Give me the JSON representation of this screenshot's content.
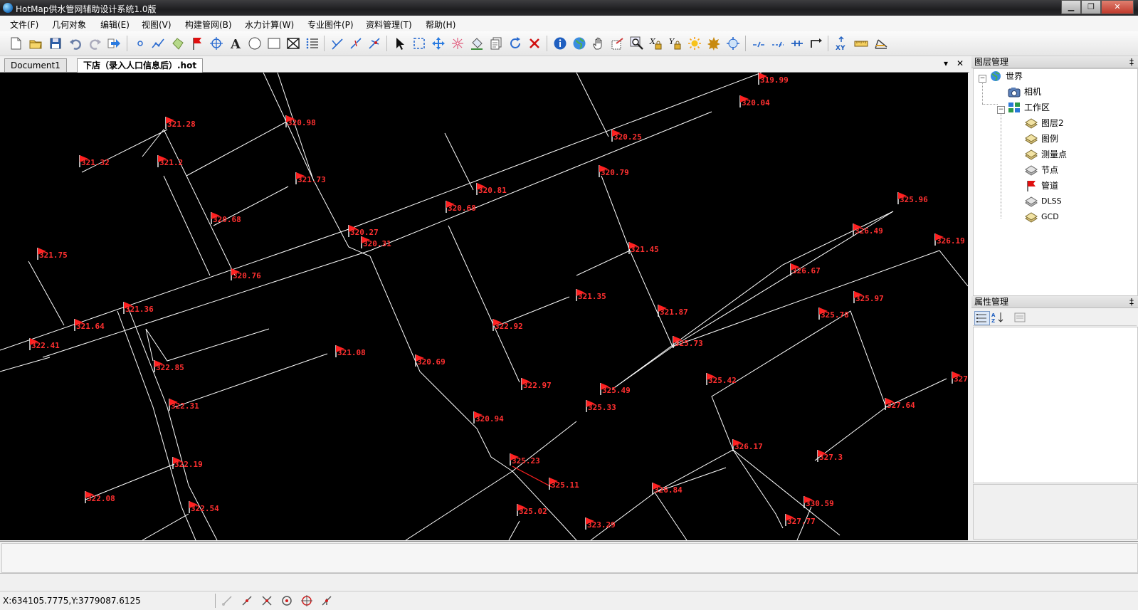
{
  "window": {
    "title": "HotMap供水管网辅助设计系统1.0版",
    "min_label": "▁",
    "max_label": "❐",
    "close_label": "✕"
  },
  "menu": [
    "文件(F)",
    "几何对象",
    "编辑(E)",
    "视图(V)",
    "构建管网(B)",
    "水力计算(W)",
    "专业图件(P)",
    "资料管理(T)",
    "帮助(H)"
  ],
  "tabs": [
    {
      "label": "Document1",
      "active": false
    },
    {
      "label": "下店（录入人口信息后）.hot",
      "active": true
    }
  ],
  "tab_controls": {
    "dropdown": "▾",
    "close": "✕"
  },
  "layer_panel": {
    "title": "图层管理",
    "pin": "‡",
    "root": "世界",
    "camera": "相机",
    "workspace": "工作区",
    "layers": [
      "图层2",
      "图例",
      "测量点",
      "节点",
      "管道",
      "DLSS",
      "GCD"
    ]
  },
  "property_panel": {
    "title": "属性管理",
    "pin": "‡"
  },
  "status": {
    "coords": "X:634105.7775,Y:3779087.6125"
  },
  "map": {
    "background": "#000000",
    "line_color": "#ffffff",
    "highlight_color": "#ff2020",
    "label_color": "#ff3030",
    "labels": [
      "319.99",
      "320.04",
      "320.25",
      "320.79",
      "320.81",
      "320.68",
      "320.98",
      "321.28",
      "321.32",
      "321.2",
      "321.73",
      "320.68",
      "320.27",
      "320.31",
      "321.45",
      "321.75",
      "320.76",
      "321.36",
      "321.64",
      "322.41",
      "321.35",
      "321.87",
      "322.92",
      "325.73",
      "321.08",
      "320.69",
      "322.85",
      "322.97",
      "325.49",
      "325.33",
      "322.31",
      "320.94",
      "325.23",
      "325.11",
      "322.19",
      "326.84",
      "322.08",
      "322.54",
      "325.02",
      "323.29",
      "325.96",
      "326.49",
      "326.19",
      "326.67",
      "325.97",
      "325.78",
      "325.42",
      "327",
      "327.64",
      "326.17",
      "327.3",
      "330.59",
      "327.77"
    ]
  }
}
